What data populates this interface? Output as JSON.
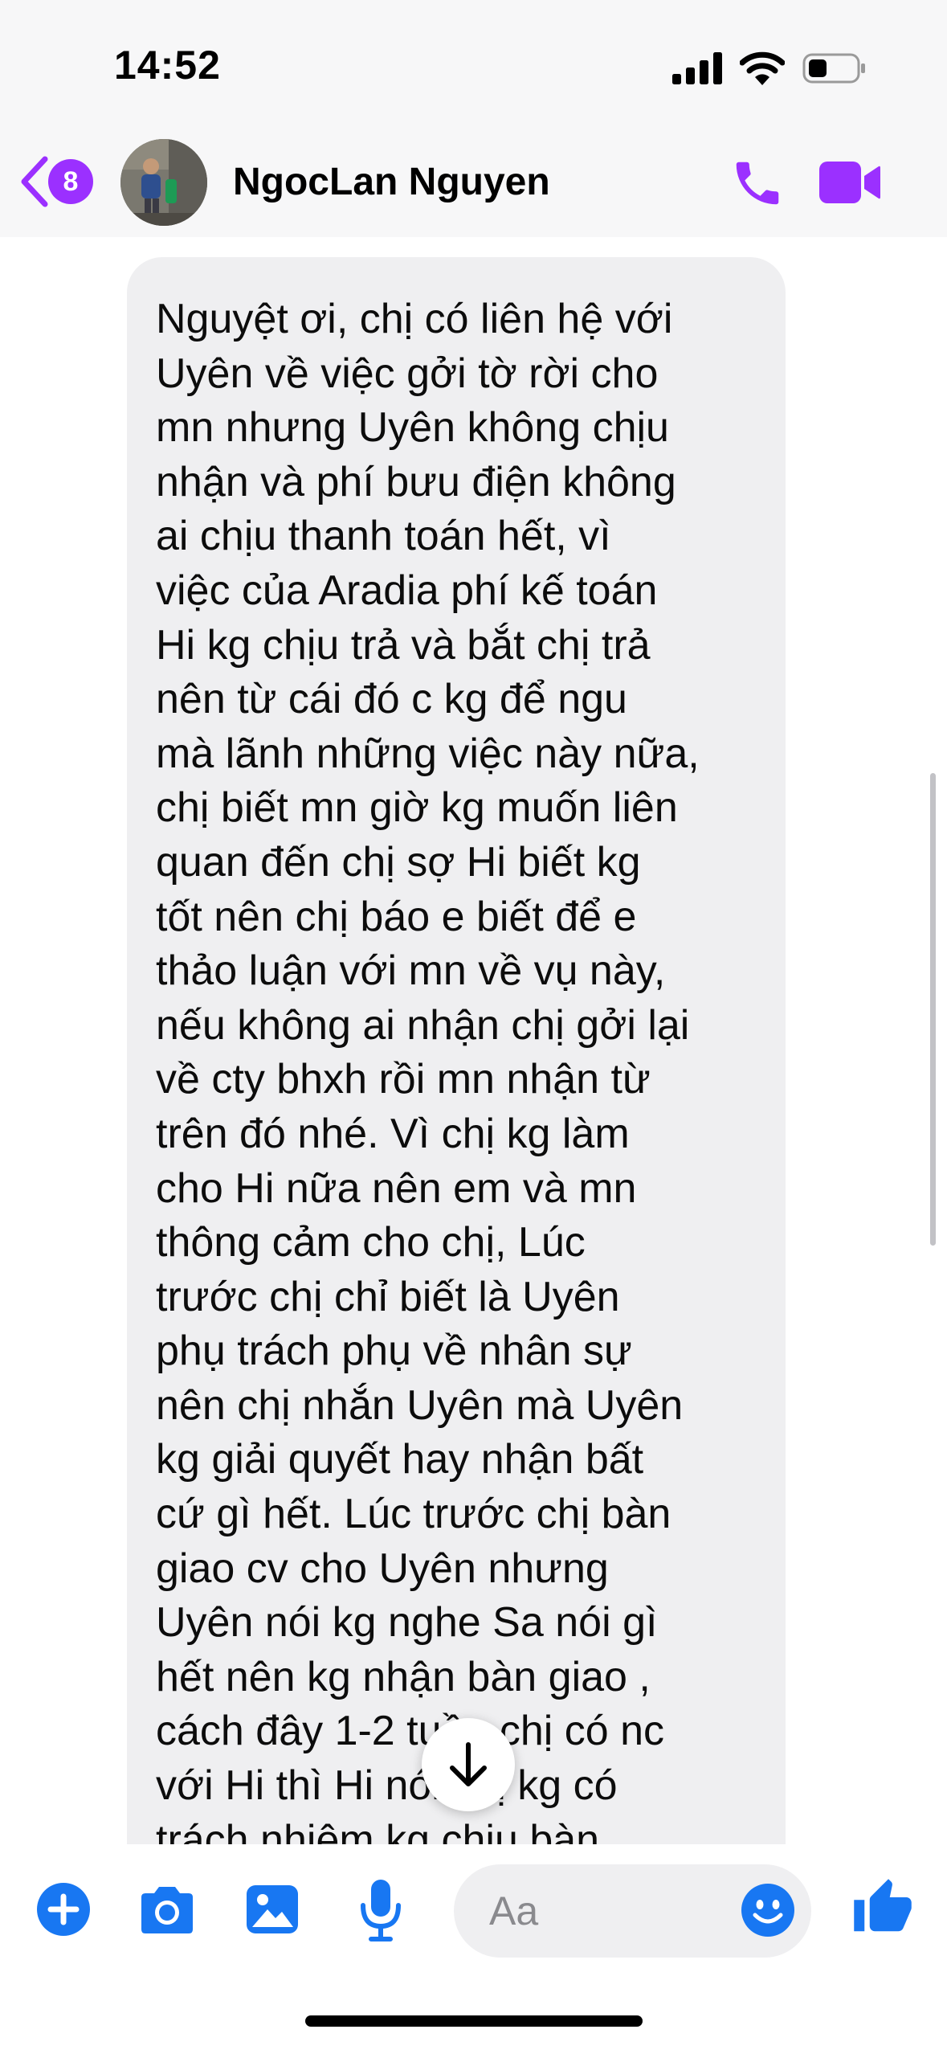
{
  "status_bar": {
    "time": "14:52",
    "icons": [
      "cellular-signal-icon",
      "wifi-icon",
      "battery-icon"
    ]
  },
  "header": {
    "back_badge_count": "8",
    "contact_name": "NgocLan Nguyen",
    "accent_color": "#9b30ff"
  },
  "message": {
    "text": "Nguyệt ơi, chị có liên hệ với\nUyên về việc gởi tờ rời cho\nmn nhưng Uyên không chịu\nnhận và phí bưu điện không\nai chịu thanh toán hết, vì\nviệc của Aradia phí kế toán\nHi kg chịu trả và bắt chị trả\nnên từ cái đó c kg để ngu\nmà lãnh những việc này nữa,\nchị biết mn giờ kg muốn liên\nquan đến chị sợ Hi biết kg\ntốt nên chị báo e biết để e\nthảo luận với mn về vụ này,\nnếu không ai nhận chị gởi lại\nvề cty bhxh rồi mn nhận từ\ntrên đó nhé. Vì chị kg làm\ncho Hi nữa nên em và mn\nthông cảm cho chị, Lúc\ntrước chị chỉ biết là Uyên\nphụ trách phụ về nhân sự\nnên chị nhắn Uyên mà Uyên\nkg giải quyết hay nhận bất\ncứ gì hết. Lúc trước chị bàn\ngiao cv cho Uyên nhưng\nUyên nói kg nghe Sa nói gì\nhết nên kg nhận bàn giao ,\ncách đây 1-2 tuần chị có nc\nvới Hi thì Hi nói chị kg có\ntrách nhiệm kg chịu bàn"
  },
  "composer": {
    "input_placeholder": "Aa",
    "icons": [
      "plus-icon",
      "camera-icon",
      "gallery-icon",
      "microphone-icon",
      "emoji-icon",
      "like-icon"
    ],
    "icon_color": "#1877f2"
  }
}
